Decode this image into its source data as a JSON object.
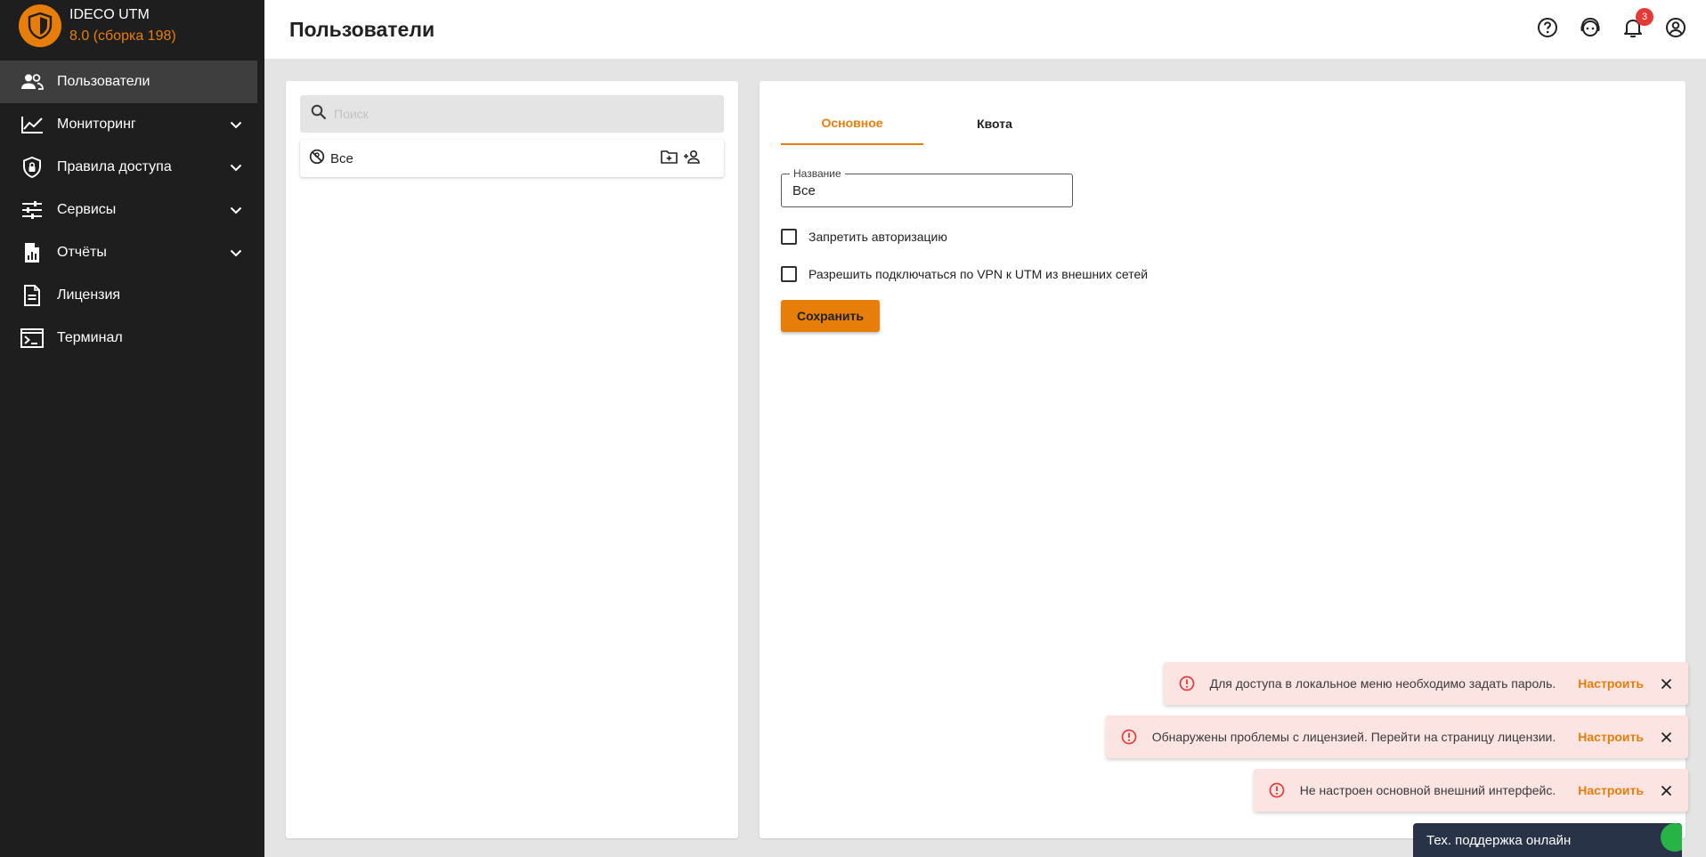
{
  "brand": {
    "name": "IDECO UTM",
    "version": "8.0 (сборка 198)",
    "accent": "#e87e0a"
  },
  "sidebar": {
    "items": [
      {
        "label": "Пользователи",
        "icon": "users-icon"
      },
      {
        "label": "Мониторинг",
        "icon": "chart-line-icon"
      },
      {
        "label": "Правила доступа",
        "icon": "shield-lock-icon"
      },
      {
        "label": "Сервисы",
        "icon": "sliders-icon"
      },
      {
        "label": "Отчёты",
        "icon": "report-file-icon"
      },
      {
        "label": "Лицензия",
        "icon": "document-icon"
      },
      {
        "label": "Терминал",
        "icon": "terminal-icon"
      }
    ]
  },
  "header": {
    "title": "Пользователи",
    "notification_count": "3"
  },
  "left": {
    "search_placeholder": "Поиск",
    "tree_item": "Все"
  },
  "right": {
    "tabs": [
      "Основное",
      "Квота"
    ],
    "name_label": "Название",
    "name_value": "Все",
    "check_deny": "Запретить авторизацию",
    "check_vpn": "Разрешить подключаться по VPN к UTM из внешних сетей",
    "save": "Сохранить"
  },
  "toasts": [
    {
      "message": "Для доступа в локальное меню необходимо задать пароль.",
      "action": "Настроить"
    },
    {
      "message": "Обнаружены проблемы с лицензией. Перейти на страницу лицензии.",
      "action": "Настроить"
    },
    {
      "message": "Не настроен основной внешний интерфейс.",
      "action": "Настроить"
    }
  ],
  "support": {
    "label": "Тех. поддержка онлайн"
  }
}
